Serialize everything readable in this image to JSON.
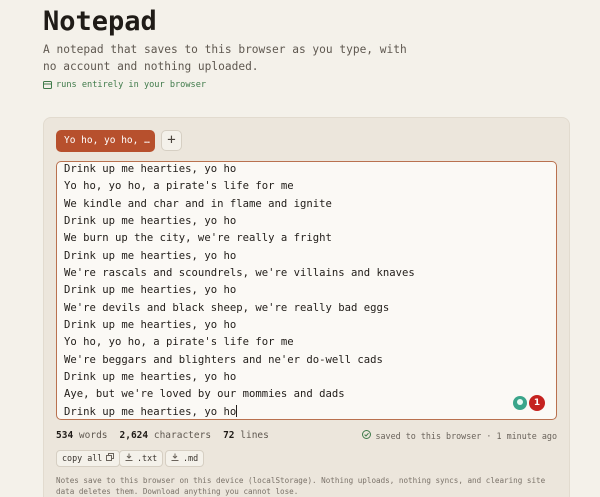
{
  "app": {
    "title": "Notepad",
    "subtitle": "A notepad that saves to this browser as you type, with no account and nothing uploaded.",
    "badge": "runs entirely in your browser"
  },
  "tabs": {
    "active_label": "Yo ho, yo ho, …",
    "add_label": "+"
  },
  "editor": {
    "lines": [
      "Drink up me hearties, yo ho",
      "Yo ho, yo ho, a pirate's life for me",
      "We kindle and char and in flame and ignite",
      "Drink up me hearties, yo ho",
      "We burn up the city, we're really a fright",
      "Drink up me hearties, yo ho",
      "We're rascals and scoundrels, we're villains and knaves",
      "Drink up me hearties, yo ho",
      "We're devils and black sheep, we're really bad eggs",
      "Drink up me hearties, yo ho",
      "Yo ho, yo ho, a pirate's life for me",
      "We're beggars and blighters and ne'er do-well cads",
      "Drink up me hearties, yo ho",
      "Aye, but we're loved by our mommies and dads",
      "Drink up me hearties, yo ho"
    ],
    "extension_badge": "1"
  },
  "stats": {
    "words_value": "534",
    "words_label": "words",
    "chars_value": "2,624",
    "chars_label": "characters",
    "lines_value": "72",
    "lines_label": "lines"
  },
  "status": {
    "saved": "saved to this browser · 1 minute ago"
  },
  "actions": {
    "copy_all": "copy all",
    "txt": ".txt",
    "md": ".md"
  },
  "footer_note": "Notes save to this browser on this device (localStorage). Nothing uploads, nothing syncs, and clearing site data deletes them. Download anything you cannot lose.",
  "colors": {
    "accent": "#b7502d",
    "badge_green": "#3f7a4a",
    "background": "#f4f1ea"
  },
  "icons": [
    "card-icon",
    "plus-icon",
    "check-circle-icon",
    "copy-icon",
    "download-icon"
  ]
}
